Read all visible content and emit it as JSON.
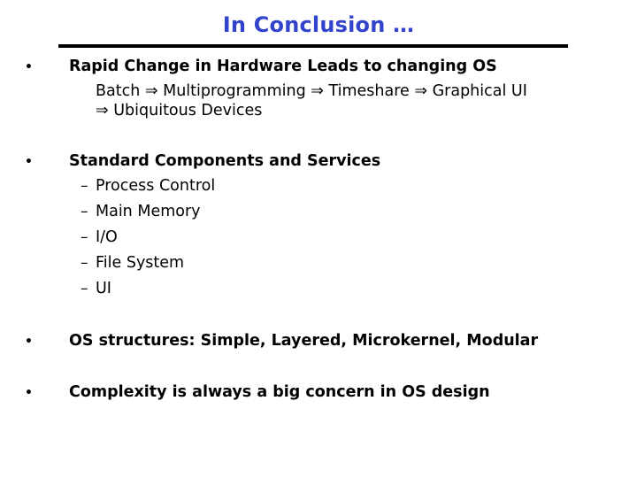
{
  "slide": {
    "title": "In Conclusion …",
    "title_color": "#3344cc",
    "bullets": [
      {
        "bullet_symbol": "•",
        "heading": "Rapid Change in Hardware Leads to changing OS",
        "details": [
          "Batch ⇒ Multiprogramming ⇒ Timeshare ⇒ Graphical UI",
          "⇒ Ubiquitous Devices"
        ]
      },
      {
        "bullet_symbol": "•",
        "heading": "Standard Components and Services",
        "sub_items": [
          {
            "dash": "–",
            "label": "Process Control"
          },
          {
            "dash": "–",
            "label": "Main Memory"
          },
          {
            "dash": "–",
            "label": "I/O"
          },
          {
            "dash": "–",
            "label": "File System"
          },
          {
            "dash": "–",
            "label": "UI"
          }
        ]
      },
      {
        "bullet_symbol": "•",
        "heading": "OS structures: Simple, Layered, Microkernel, Modular"
      },
      {
        "bullet_symbol": "•",
        "heading": "Complexity is always a big concern in OS design"
      }
    ]
  }
}
